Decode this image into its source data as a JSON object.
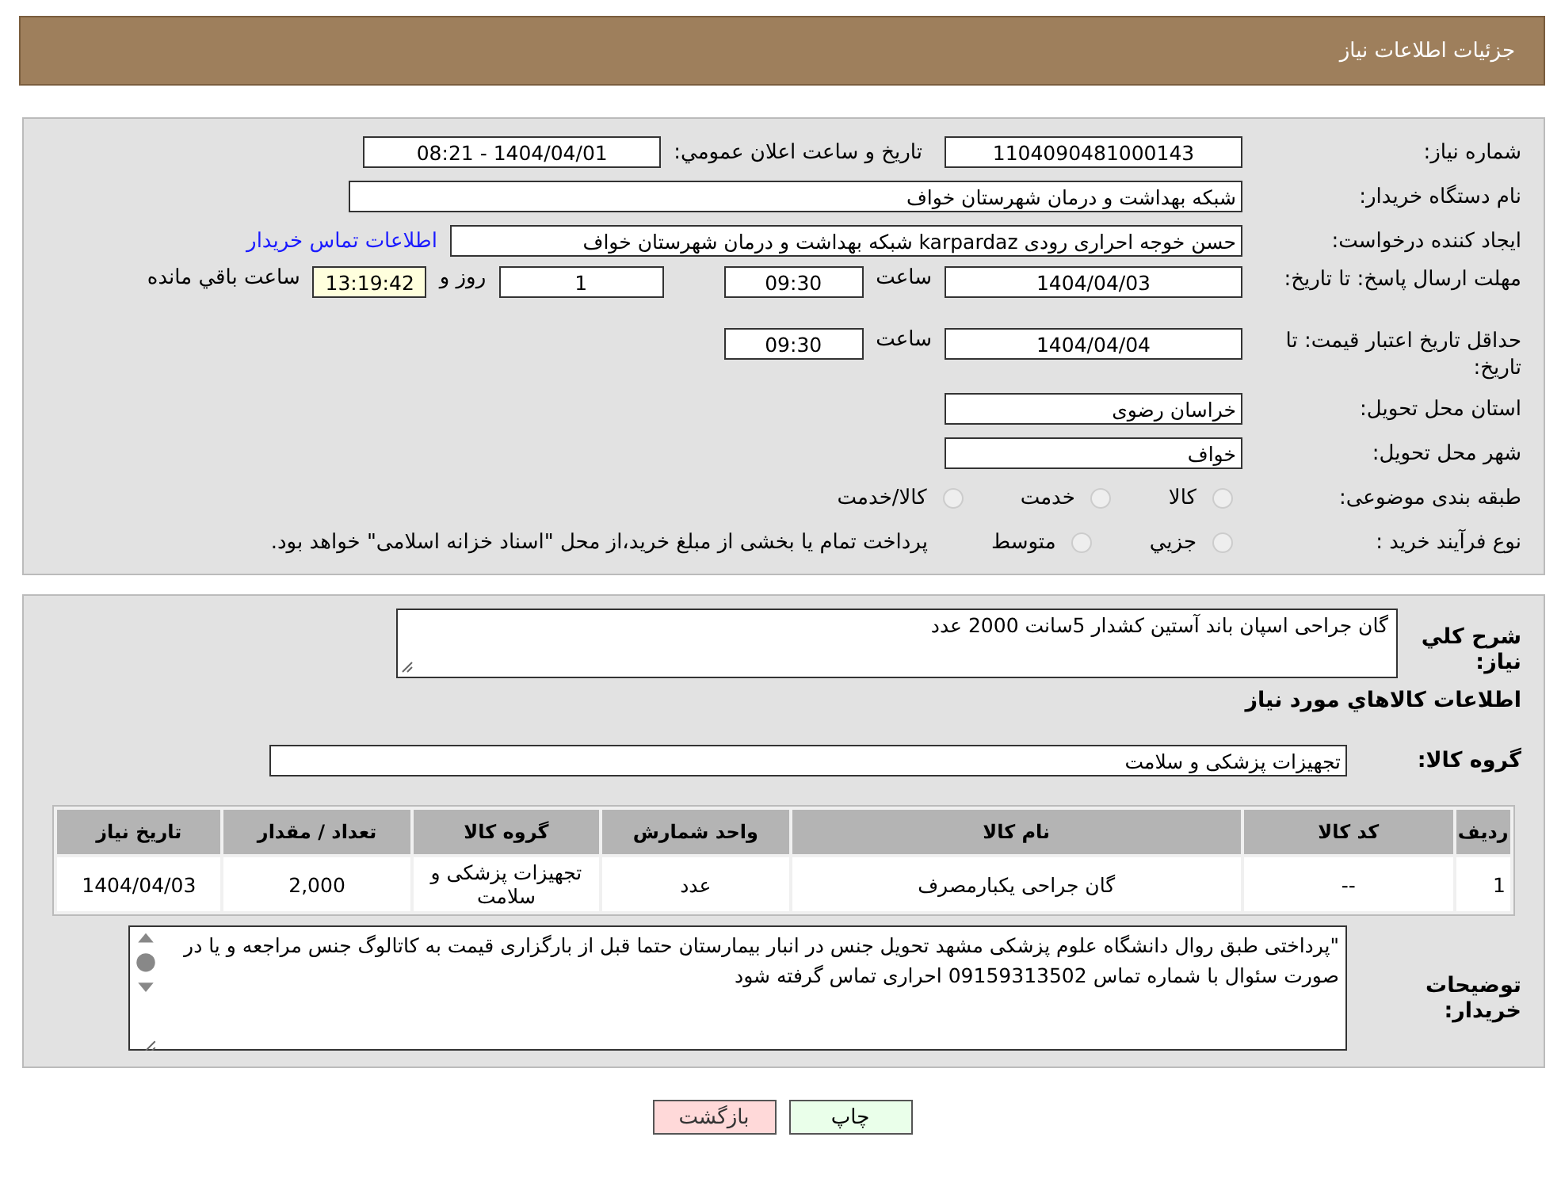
{
  "header": {
    "title": "جزئیات اطلاعات نیاز"
  },
  "details": {
    "need_number": {
      "label": "شماره نیاز:",
      "value": "1104090481000143"
    },
    "announce": {
      "label": "تاریخ و ساعت اعلان عمومي:",
      "value": "1404/04/01 - 08:21"
    },
    "buyer_org": {
      "label": "نام دستگاه خریدار:",
      "value": "شبکه بهداشت و درمان شهرستان خواف"
    },
    "requester": {
      "label": "ایجاد کننده درخواست:",
      "value": "حسن خوجه احراری رودی karpardaz شبکه بهداشت و درمان شهرستان خواف",
      "link": "اطلاعات تماس خریدار"
    },
    "reply_deadline": {
      "label": "مهلت ارسال پاسخ: تا تاریخ:",
      "date": "1404/04/03",
      "time_label": "ساعت",
      "time": "09:30",
      "days": "1",
      "days_label": "روز و",
      "remaining": "13:19:42",
      "remaining_label": "ساعت باقي مانده"
    },
    "price_validity": {
      "label": "حداقل تاریخ اعتبار قیمت: تا تاریخ:",
      "date": "1404/04/04",
      "time_label": "ساعت",
      "time": "09:30"
    },
    "province": {
      "label": "استان محل تحویل:",
      "value": "خراسان رضوی"
    },
    "city": {
      "label": "شهر محل تحویل:",
      "value": "خواف"
    },
    "category": {
      "label": "طبقه بندی موضوعی:",
      "options": [
        {
          "label": "کالا",
          "selected": false
        },
        {
          "label": "خدمت",
          "selected": false
        },
        {
          "label": "کالا/خدمت",
          "selected": false
        }
      ]
    },
    "process": {
      "label": "نوع فرآیند خرید :",
      "options": [
        {
          "label": "جزیي",
          "selected": false
        },
        {
          "label": "متوسط",
          "selected": false
        }
      ],
      "note": "پرداخت تمام یا بخشی از مبلغ خرید،از محل \"اسناد خزانه اسلامی\" خواهد بود."
    }
  },
  "summary": {
    "label": "شرح کلي نیاز:",
    "value": "گان جراحی اسپان باند آستین کشدار 5سانت 2000 عدد"
  },
  "goods_title": "اطلاعات کالاهاي مورد نیاز",
  "goods_group": {
    "label": "گروه کالا:",
    "value": "تجهیزات پزشکی و سلامت"
  },
  "table": {
    "columns": [
      "ردیف",
      "کد کالا",
      "نام کالا",
      "واحد شمارش",
      "گروه کالا",
      "تعداد / مقدار",
      "تاریخ نیاز"
    ],
    "rows": [
      [
        "1",
        "--",
        "گان جراحی یکبارمصرف",
        "عدد",
        "تجهیزات پزشکی و سلامت",
        "2,000",
        "1404/04/03"
      ]
    ]
  },
  "buyer_notes": {
    "label": "توضیحات خریدار:",
    "value": "\"پرداختی طبق روال دانشگاه علوم پزشکی مشهد تحویل جنس در انبار بیمارستان  حتما قبل از بارگزاری قیمت به کاتالوگ جنس مراجعه و یا در صورت سئوال با  شماره تماس 09159313502 احراری تماس گرفته شود"
  },
  "buttons": [
    {
      "label": "چاپ",
      "kind": "print"
    },
    {
      "label": "بازگشت",
      "kind": "back"
    }
  ]
}
